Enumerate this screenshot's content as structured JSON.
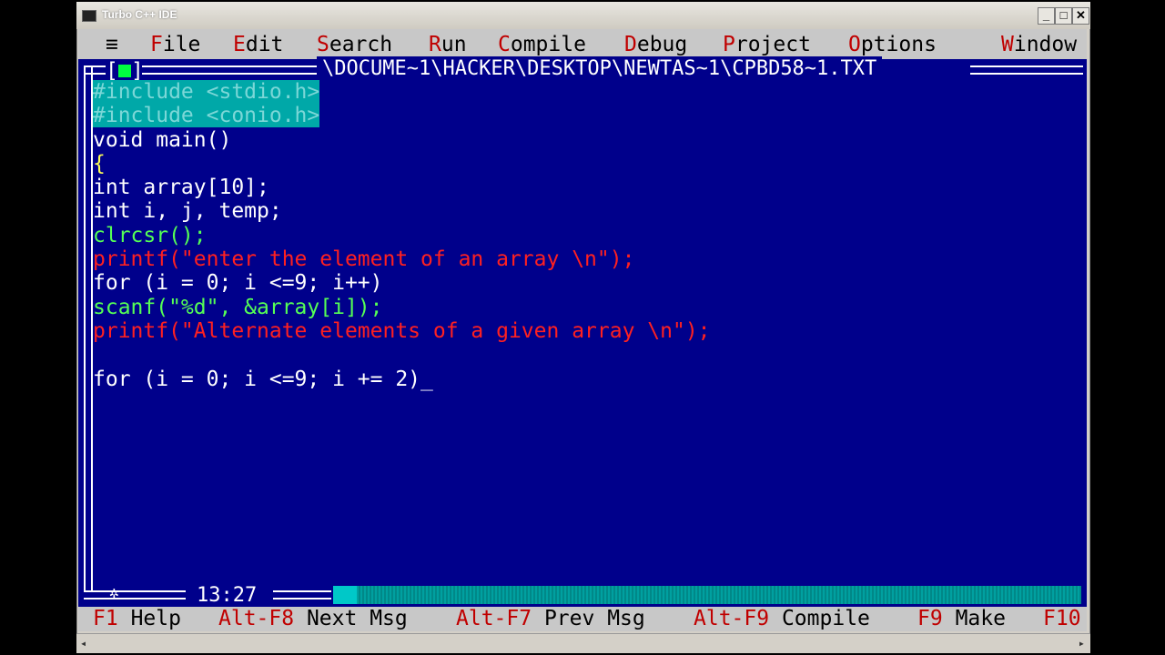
{
  "window": {
    "title": "Turbo C++ IDE",
    "controls": {
      "minimize": "_",
      "maximize": "□",
      "close": "✕"
    }
  },
  "menu": {
    "system": "≡",
    "items": [
      {
        "hot": "F",
        "rest": "ile"
      },
      {
        "hot": "E",
        "rest": "dit"
      },
      {
        "hot": "S",
        "rest": "earch"
      },
      {
        "hot": "R",
        "rest": "un"
      },
      {
        "hot": "C",
        "rest": "ompile"
      },
      {
        "hot": "D",
        "rest": "ebug"
      },
      {
        "hot": "P",
        "rest": "roject"
      },
      {
        "hot": "O",
        "rest": "ptions"
      },
      {
        "hot": "W",
        "rest": "indow"
      }
    ]
  },
  "editor": {
    "file_path": "\\DOCUME~1\\HACKER\\DESKTOP\\NEWTAS~1\\CPBD58~1.TXT",
    "lines": [
      "#include <stdio.h>",
      "#include <conio.h>",
      "void main()",
      "{",
      "int array[10];",
      "int i, j, temp;",
      "clrcsr();",
      "printf(\"enter the element of an array \\n\");",
      "for (i = 0; i <=9; i++)",
      "scanf(\"%d\", &array[i]);",
      "printf(\"Alternate elements of a given array \\n\");",
      "",
      "for (i = 0; i <=9; i += 2)_"
    ],
    "cursor_position": "13:27"
  },
  "statusbar": {
    "items": [
      {
        "key": "F1",
        "label": "Help"
      },
      {
        "key": "Alt-F8",
        "label": "Next Msg"
      },
      {
        "key": "Alt-F7",
        "label": "Prev Msg"
      },
      {
        "key": "Alt-F9",
        "label": "Compile"
      },
      {
        "key": "F9",
        "label": "Make"
      },
      {
        "key": "F10",
        "label": ""
      }
    ]
  },
  "icons": {
    "close_box": "close-box-icon",
    "scroll_left": "scroll-left-arrow-icon",
    "scroll_right": "scroll-right-arrow-icon"
  },
  "colors": {
    "editor_bg": "#00008b",
    "menu_bg": "#c8c8c8",
    "hotkey": "#c00000",
    "selection": "#00a8a8",
    "string": "#ff2020",
    "function": "#55ff55",
    "identifier": "#ffff55"
  }
}
